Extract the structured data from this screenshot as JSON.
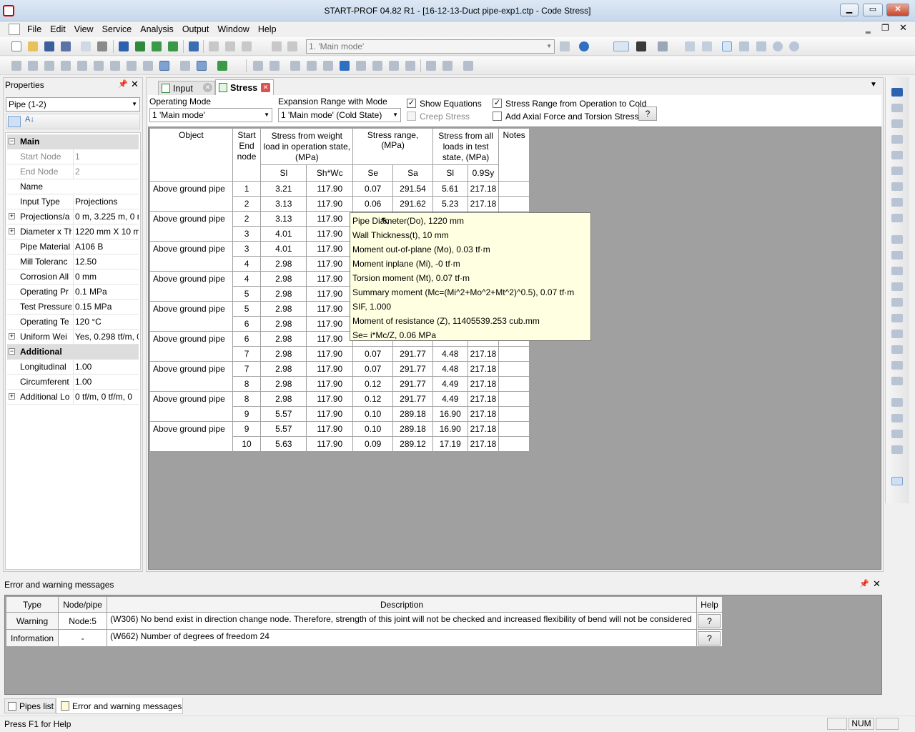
{
  "window": {
    "title": "START-PROF 04.82 R1 - [16-12-13-Duct pipe-exp1.ctp - Code Stress]"
  },
  "menu": [
    "File",
    "Edit",
    "View",
    "Service",
    "Analysis",
    "Output",
    "Window",
    "Help"
  ],
  "toolbar": {
    "mode_combo": "1. 'Main mode'"
  },
  "properties": {
    "title": "Properties",
    "selector": "Pipe (1-2)",
    "categories": {
      "main": "Main",
      "additional": "Additional"
    },
    "main_rows": [
      {
        "k": "Start Node",
        "v": "1"
      },
      {
        "k": "End Node",
        "v": "2"
      },
      {
        "k": "Name",
        "v": ""
      },
      {
        "k": "Input Type",
        "v": "Projections"
      },
      {
        "k": "Projections/a",
        "v": "0 m, 3.225 m, 0 m"
      },
      {
        "k": "Diameter x Th",
        "v": "1220 mm X 10 mm"
      },
      {
        "k": "Pipe Material",
        "v": "A106 B"
      },
      {
        "k": "Mill Toleranc",
        "v": "12.50"
      },
      {
        "k": "Corrosion All",
        "v": "0 mm"
      },
      {
        "k": "Operating Pr",
        "v": "0.1 MPa"
      },
      {
        "k": "Test Pressure,",
        "v": "0.15 MPa"
      },
      {
        "k": "Operating Te",
        "v": "120 °C"
      },
      {
        "k": "Uniform Wei",
        "v": "Yes, 0.298 tf/m, 0"
      }
    ],
    "additional_rows": [
      {
        "k": "Longitudinal",
        "v": "1.00"
      },
      {
        "k": "Circumferent",
        "v": "1.00"
      },
      {
        "k": "Additional Lo",
        "v": "0 tf/m, 0 tf/m, 0"
      }
    ]
  },
  "tabs": {
    "input": "Input",
    "stress": "Stress"
  },
  "stress_controls": {
    "operating_mode_label": "Operating Mode",
    "operating_mode_value": "1 'Main mode'",
    "expansion_label": "Expansion Range with Mode",
    "expansion_value": "1 'Main mode' (Cold State)",
    "show_equations": "Show Equations",
    "creep_stress": "Creep Stress",
    "stress_range": "Stress Range from Operation to Cold",
    "axial_torsion": "Add Axial Force and Torsion Stress",
    "help": "?"
  },
  "table": {
    "h_object": "Object",
    "h_nodes": "Start End node",
    "h_weight": "Stress from weight load in operation state, (MPa)",
    "h_range": "Stress range, (MPa)",
    "h_test": "Stress from all loads in test state, (MPa)",
    "h_notes": "Notes",
    "sub": [
      "Sl",
      "Sh*Wc",
      "Se",
      "Sa",
      "Sl",
      "0.9Sy"
    ],
    "rows": [
      {
        "obj": "Above ground pipe",
        "a": [
          "1",
          "3.21",
          "117.90",
          "0.07",
          "291.54",
          "5.61",
          "217.18"
        ],
        "b": [
          "2",
          "3.13",
          "117.90",
          "0.06",
          "291.62",
          "5.23",
          "217.18"
        ]
      },
      {
        "obj": "Above ground pipe",
        "a": [
          "2",
          "3.13",
          "117.90",
          "",
          "",
          "",
          ""
        ],
        "b": [
          "3",
          "4.01",
          "117.90",
          "",
          "",
          "",
          ""
        ]
      },
      {
        "obj": "Above ground pipe",
        "a": [
          "3",
          "4.01",
          "117.90",
          "",
          "",
          "",
          ""
        ],
        "b": [
          "4",
          "2.98",
          "117.90",
          "",
          "",
          "",
          ""
        ]
      },
      {
        "obj": "Above ground pipe",
        "a": [
          "4",
          "2.98",
          "117.90",
          "",
          "",
          "",
          ""
        ],
        "b": [
          "5",
          "2.98",
          "117.90",
          "",
          "",
          "",
          ""
        ]
      },
      {
        "obj": "Above ground pipe",
        "a": [
          "5",
          "2.98",
          "117.90",
          "",
          "",
          "",
          ""
        ],
        "b": [
          "6",
          "2.98",
          "117.90",
          "",
          "",
          "",
          ""
        ]
      },
      {
        "obj": "Above ground pipe",
        "a": [
          "6",
          "2.98",
          "117.90",
          "",
          "",
          "",
          ""
        ],
        "b": [
          "7",
          "2.98",
          "117.90",
          "0.07",
          "291.77",
          "4.48",
          "217.18"
        ]
      },
      {
        "obj": "Above ground pipe",
        "a": [
          "7",
          "2.98",
          "117.90",
          "0.07",
          "291.77",
          "4.48",
          "217.18"
        ],
        "b": [
          "8",
          "2.98",
          "117.90",
          "0.12",
          "291.77",
          "4.49",
          "217.18"
        ]
      },
      {
        "obj": "Above ground pipe",
        "a": [
          "8",
          "2.98",
          "117.90",
          "0.12",
          "291.77",
          "4.49",
          "217.18"
        ],
        "b": [
          "9",
          "5.57",
          "117.90",
          "0.10",
          "289.18",
          "16.90",
          "217.18"
        ]
      },
      {
        "obj": "Above ground pipe",
        "a": [
          "9",
          "5.57",
          "117.90",
          "0.10",
          "289.18",
          "16.90",
          "217.18"
        ],
        "b": [
          "10",
          "5.63",
          "117.90",
          "0.09",
          "289.12",
          "17.19",
          "217.18"
        ]
      }
    ]
  },
  "tooltip": [
    "Pipe Diameter(Do), 1220 mm",
    "Wall Thickness(t), 10 mm",
    "Moment out-of-plane (Mo), 0.03 tf·m",
    "Moment inplane   (Mi), -0 tf·m",
    "Torsion moment (Mt), 0.07 tf·m",
    "Summary moment (Mc=(Mi^2+Mo^2+Mt^2)^0.5), 0.07 tf·m",
    "SIF,  1.000",
    "Moment of resistance (Z), 11405539.253 cub.mm",
    "Se= i*Mc/Z, 0.06 MPa"
  ],
  "errors": {
    "title": "Error and warning messages",
    "headers": [
      "Type",
      "Node/pipe",
      "Description",
      "Help"
    ],
    "rows": [
      {
        "type": "Warning",
        "node": "Node:5",
        "desc": "(W306) No bend exist in direction change node. Therefore, strength of this joint will not be checked and increased flexibility of bend will not be considered",
        "help": "?"
      },
      {
        "type": "Information",
        "node": "-",
        "desc": "(W662) Number of degrees of freedom 24",
        "help": "?"
      }
    ]
  },
  "bottom_tabs": {
    "pipes": "Pipes list",
    "errors": "Error and warning messages"
  },
  "status": {
    "help": "Press F1 for Help",
    "num": "NUM"
  },
  "colors": {
    "accent": "#3c7fb1",
    "table_bg": "#ffffff",
    "workspace": "#a0a0a0",
    "tooltip_bg": "#ffffe1"
  }
}
